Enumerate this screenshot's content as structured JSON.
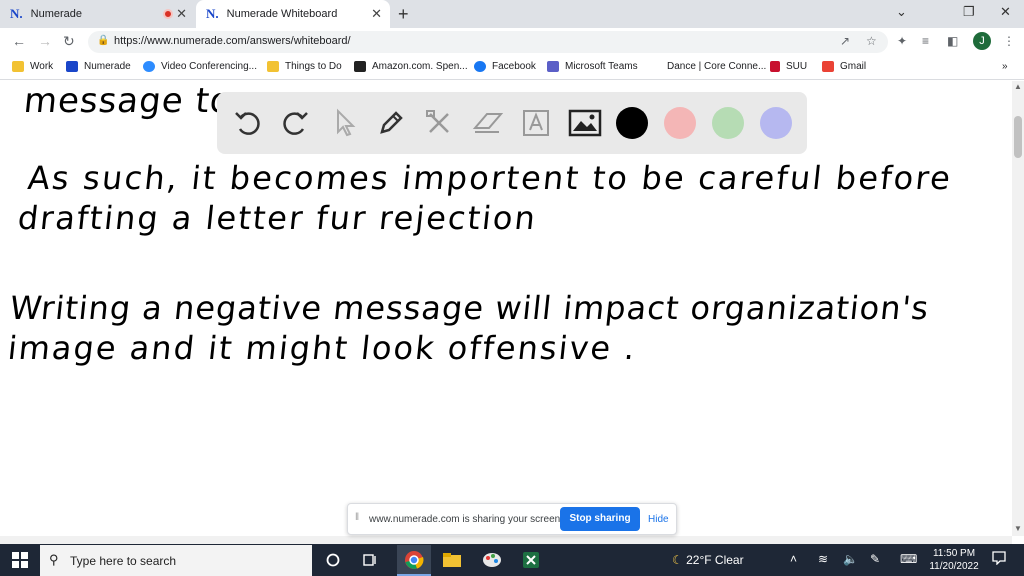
{
  "browser": {
    "tabs": [
      {
        "favicon": "N.",
        "label": "Numerade",
        "close": "✕"
      },
      {
        "favicon": "N.",
        "label": "Numerade Whiteboard",
        "close": "✕"
      }
    ],
    "new_tab": "+",
    "window_controls": {
      "minimize": "⌄",
      "restore": "❐",
      "close": "✕"
    },
    "url": "https://www.numerade.com/answers/whiteboard/",
    "avatar_letter": "J"
  },
  "bookmarks": [
    {
      "label": "Work",
      "icon": "folder-icon",
      "color": "#f2c233"
    },
    {
      "label": "Numerade",
      "icon": "numerade-icon",
      "color": "#1a46c9"
    },
    {
      "label": "Video Conferencing...",
      "icon": "zoom-icon",
      "color": "#2d8cff"
    },
    {
      "label": "Things to Do",
      "icon": "folder-icon",
      "color": "#f2c233"
    },
    {
      "label": "Amazon.com. Spen...",
      "icon": "amazon-icon",
      "color": "#222222"
    },
    {
      "label": "Facebook",
      "icon": "facebook-icon",
      "color": "#1877f2"
    },
    {
      "label": "Microsoft Teams",
      "icon": "teams-icon",
      "color": "#5b5fc7"
    },
    {
      "label": "Dance | Core Conne...",
      "icon": "blank-icon",
      "color": "#ffffff"
    },
    {
      "label": "SUU",
      "icon": "suu-icon",
      "color": "#c8102e"
    },
    {
      "label": "Gmail",
      "icon": "gmail-icon",
      "color": "#ea4335"
    }
  ],
  "bookmarks_more": "»",
  "whiteboard": {
    "lines": [
      "message to",
      "As such, it becomes importent to be careful before",
      "drafting a letter fur rejection",
      "Writing a negative message will impact organization's",
      "image and it might look offensive ."
    ],
    "tools": [
      "undo-icon",
      "redo-icon",
      "pointer-icon",
      "pen-icon",
      "tools-icon",
      "eraser-icon",
      "text-icon",
      "image-icon"
    ],
    "colors": [
      "#000000",
      "#f4b6b6",
      "#b6dcb4",
      "#b6b8f0"
    ],
    "selected_color": "#000000"
  },
  "share_bar": {
    "text": "www.numerade.com is sharing your screen.",
    "stop_label": "Stop sharing",
    "hide_label": "Hide"
  },
  "taskbar": {
    "search_placeholder": "Type here to search",
    "weather": "22°F  Clear",
    "time": "11:50 PM",
    "date": "11/20/2022"
  }
}
